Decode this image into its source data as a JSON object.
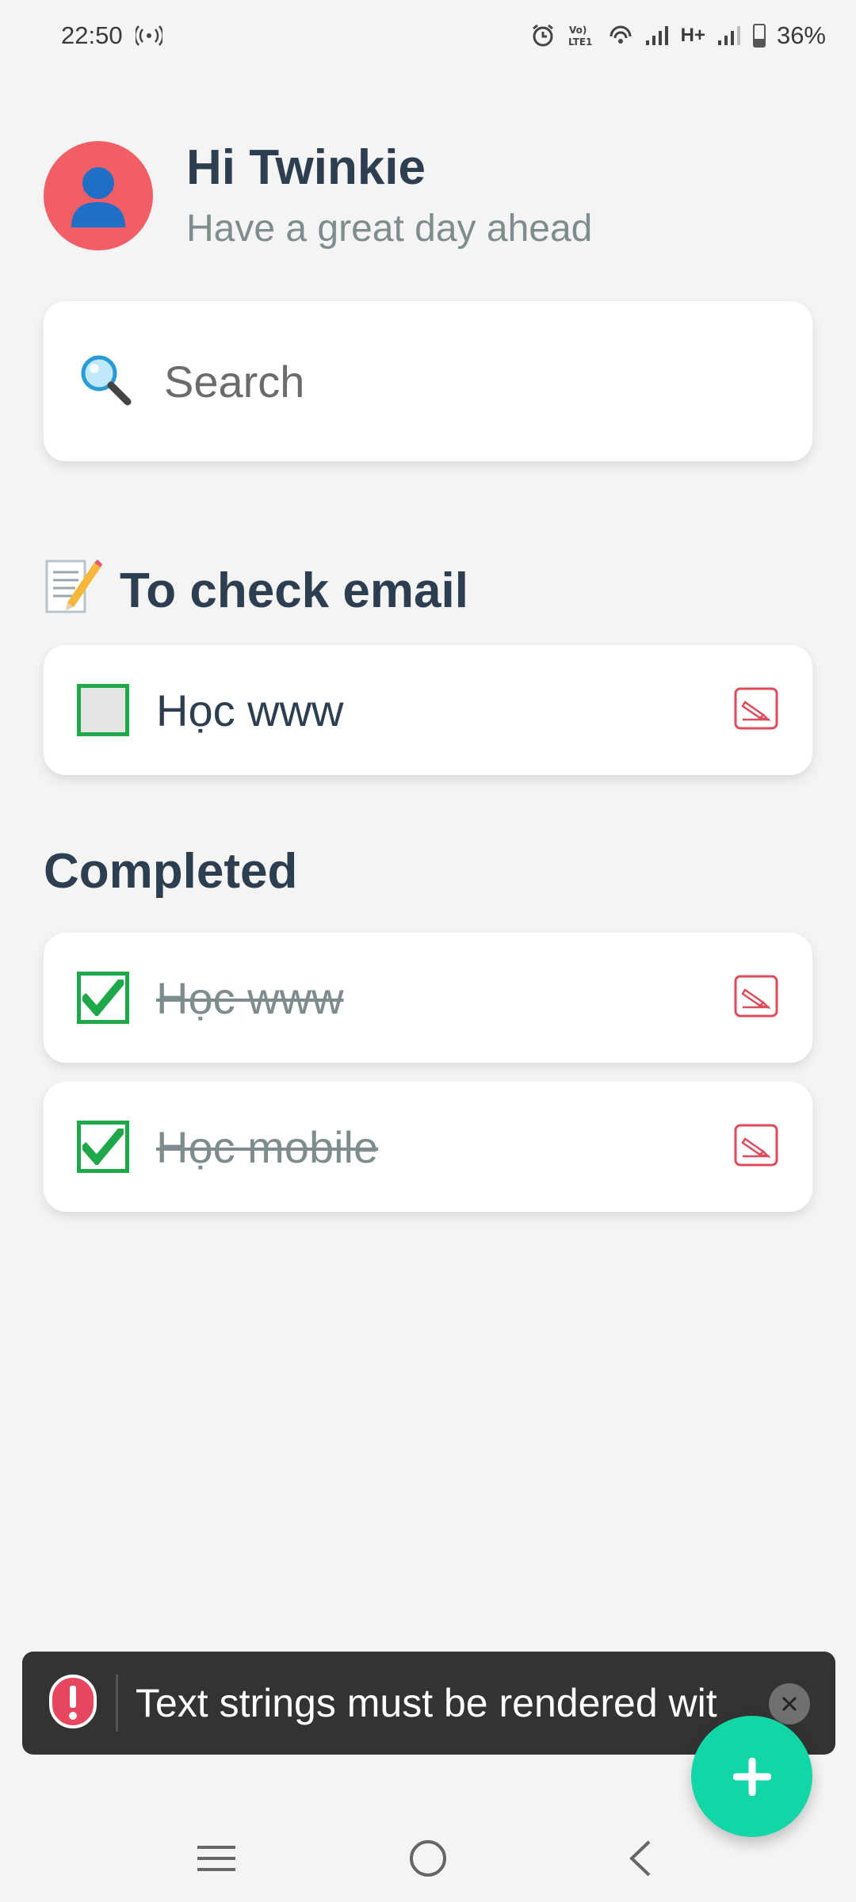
{
  "status_bar": {
    "time": "22:50",
    "network_label": "H+",
    "volte_label": "Vo) LTE1",
    "battery_percent": "36%",
    "battery_level": 0.36
  },
  "header": {
    "greeting": "Hi Twinkie",
    "subtitle": "Have a great day ahead",
    "avatar_icon": "person-silhouette-icon"
  },
  "search": {
    "placeholder": "Search",
    "value": ""
  },
  "sections": {
    "todo": {
      "title": "To check email",
      "icon": "memo-icon",
      "items": [
        {
          "label": "Học www",
          "checked": false
        }
      ]
    },
    "completed": {
      "title": "Completed",
      "items": [
        {
          "label": "Học www",
          "checked": true
        },
        {
          "label": "Học mobile",
          "checked": true
        }
      ]
    }
  },
  "toast": {
    "message": "Text strings must be rendered wit",
    "icon": "error-icon"
  },
  "colors": {
    "accent_fab": "#13d6a6",
    "avatar_bg": "#f15e66",
    "checkbox_green": "#1ea84a",
    "edit_red": "#e04a5a",
    "toast_bg": "#333333"
  }
}
